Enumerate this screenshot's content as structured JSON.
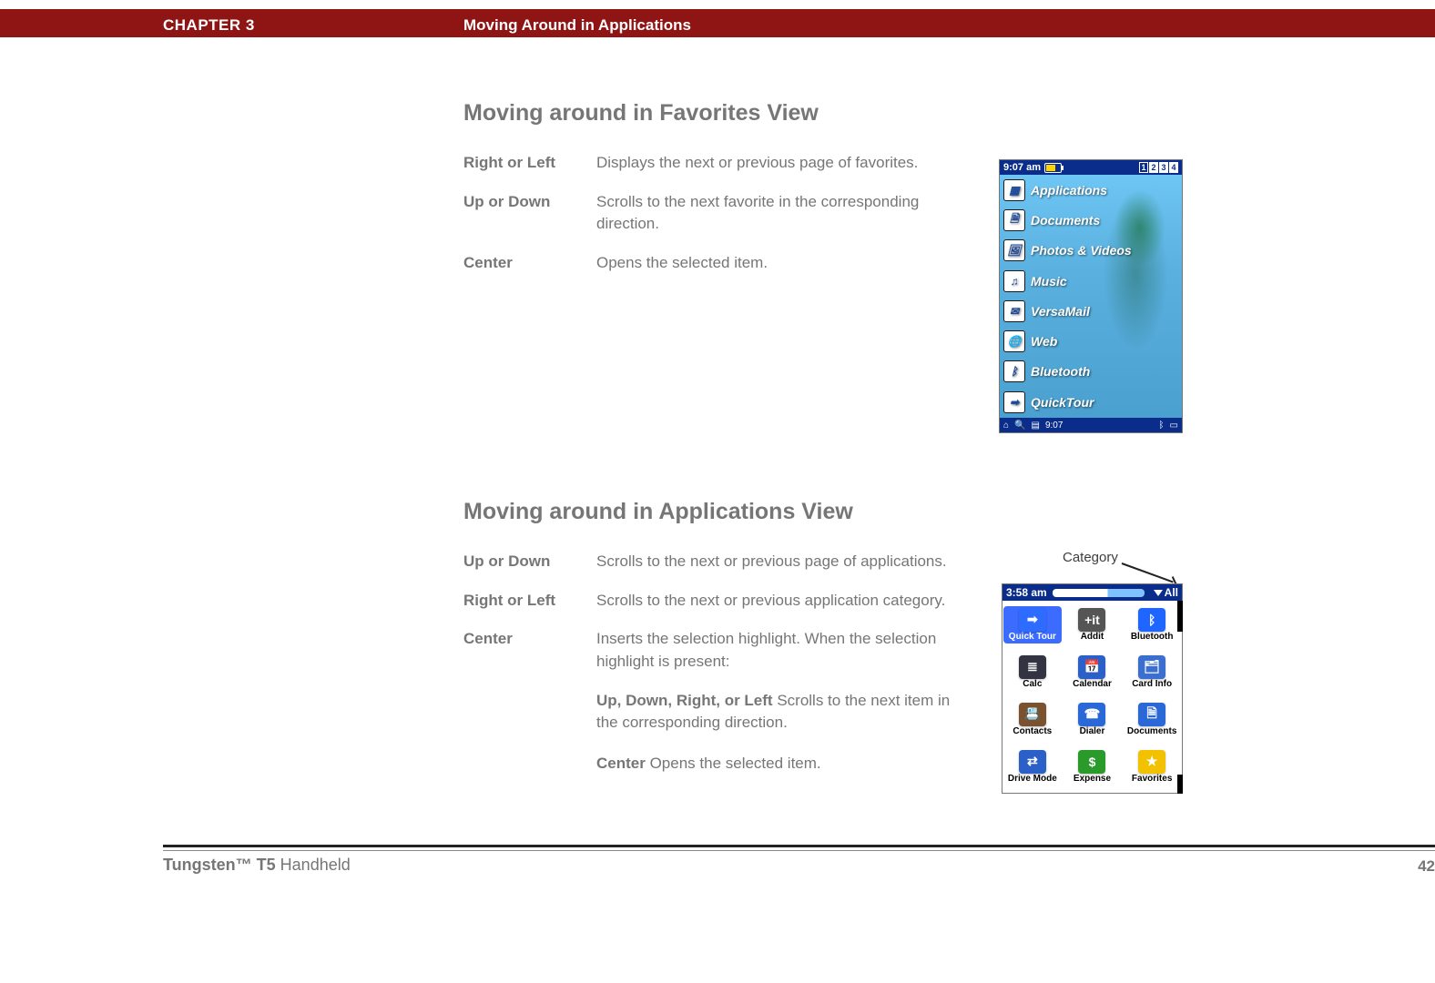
{
  "header": {
    "chapter": "CHAPTER 3",
    "title": "Moving Around in Applications"
  },
  "section1": {
    "heading": "Moving around in Favorites View",
    "rows": [
      {
        "term": "Right or Left",
        "defn": "Displays the next or previous page of favorites."
      },
      {
        "term": "Up or Down",
        "defn": "Scrolls to the next favorite in the corresponding direction."
      },
      {
        "term": "Center",
        "defn": "Opens the selected item."
      }
    ]
  },
  "section2": {
    "heading": "Moving around in Applications View",
    "rows": [
      {
        "term": "Up or Down",
        "defn": "Scrolls to the next or previous page of applications."
      },
      {
        "term": "Right or Left",
        "defn": "Scrolls to the next or previous application category."
      },
      {
        "term": "Center",
        "defn": "Inserts the selection highlight. When the selection highlight is present:"
      }
    ],
    "subs": [
      {
        "label": "Up, Down, Right, or Left",
        "text": "  Scrolls to the next item in the corresponding direction."
      },
      {
        "label": "Center",
        "text": "  Opens the selected item."
      }
    ]
  },
  "device1": {
    "time": "9:07 am",
    "tabs": [
      "1",
      "2",
      "3",
      "4"
    ],
    "items": [
      {
        "icon": "grid",
        "label": "Applications"
      },
      {
        "icon": "doc",
        "label": "Documents"
      },
      {
        "icon": "photo",
        "label": "Photos & Videos"
      },
      {
        "icon": "music",
        "label": "Music"
      },
      {
        "icon": "mail",
        "label": "VersaMail"
      },
      {
        "icon": "web",
        "label": "Web"
      },
      {
        "icon": "bt",
        "label": "Bluetooth"
      },
      {
        "icon": "tour",
        "label": "QuickTour"
      }
    ],
    "statusbar_time": "9:07"
  },
  "device2": {
    "time": "3:58 am",
    "category": "All",
    "apps": [
      {
        "label": "Quick Tour",
        "color": "#2e6bff",
        "glyph": "➡",
        "sel": true
      },
      {
        "label": "Addit",
        "color": "#555",
        "glyph": "+it"
      },
      {
        "label": "Bluetooth",
        "color": "#1e66ff",
        "glyph": "ᛒ"
      },
      {
        "label": "Calc",
        "color": "#334",
        "glyph": "≣"
      },
      {
        "label": "Calendar",
        "color": "#2a60c8",
        "glyph": "📅"
      },
      {
        "label": "Card Info",
        "color": "#3a6fd0",
        "glyph": "🗂"
      },
      {
        "label": "Contacts",
        "color": "#7a5230",
        "glyph": "📇"
      },
      {
        "label": "Dialer",
        "color": "#2a68d8",
        "glyph": "☎"
      },
      {
        "label": "Documents",
        "color": "#2a68d8",
        "glyph": "🗎"
      },
      {
        "label": "Drive Mode",
        "color": "#2a60c8",
        "glyph": "⇄"
      },
      {
        "label": "Expense",
        "color": "#2a9a2a",
        "glyph": "$"
      },
      {
        "label": "Favorites",
        "color": "#f2c200",
        "glyph": "★"
      }
    ]
  },
  "callout": {
    "label": "Category"
  },
  "footer": {
    "product_bold": "Tungsten™ T5",
    "product_rest": " Handheld",
    "page": "42"
  }
}
